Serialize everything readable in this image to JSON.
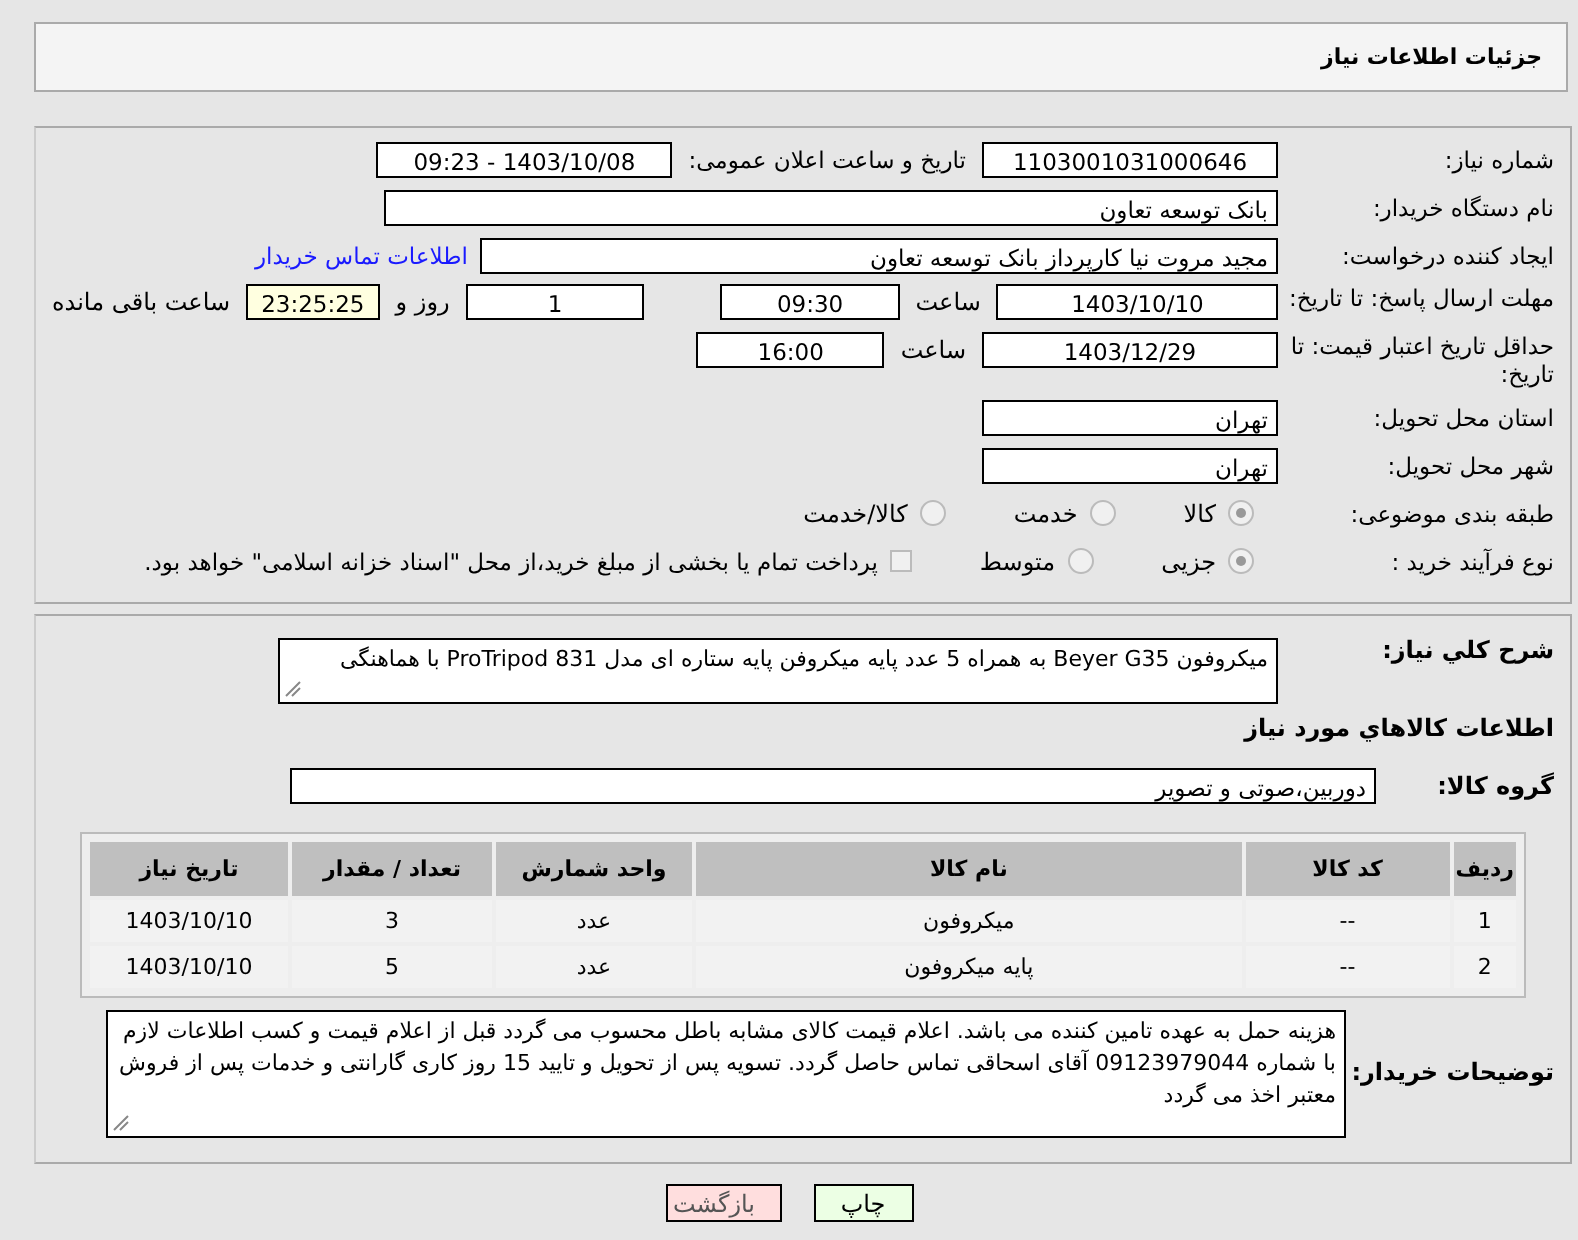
{
  "header": {
    "title": "جزئیات اطلاعات نیاز"
  },
  "need_number": {
    "label": "شماره نیاز:",
    "value": "1103001031000646"
  },
  "announce": {
    "label": "تاریخ و ساعت اعلان عمومی:",
    "value": "1403/10/08 - 09:23"
  },
  "buyer": {
    "label": "نام دستگاه خریدار:",
    "value": "بانک توسعه تعاون"
  },
  "creator": {
    "label": "ایجاد کننده درخواست:",
    "value": "مجید مروت نیا کارپرداز بانک توسعه تعاون",
    "link": "اطلاعات تماس خریدار"
  },
  "deadline": {
    "label": "مهلت ارسال پاسخ: تا تاریخ:",
    "date": "1403/10/10",
    "time_label": "ساعت",
    "time": "09:30",
    "days": "1",
    "days_label": "روز و",
    "remaining": "23:25:25",
    "remaining_label": "ساعت باقی مانده"
  },
  "validity": {
    "label": "حداقل تاریخ اعتبار قیمت: تا تاریخ:",
    "date": "1403/12/29",
    "time_label": "ساعت",
    "time": "16:00"
  },
  "province": {
    "label": "استان محل تحویل:",
    "value": "تهران"
  },
  "city": {
    "label": "شهر محل تحویل:",
    "value": "تهران"
  },
  "category": {
    "label": "طبقه بندی موضوعی:",
    "options": [
      {
        "label": "کالا",
        "selected": true
      },
      {
        "label": "خدمت",
        "selected": false
      },
      {
        "label": "کالا/خدمت",
        "selected": false
      }
    ]
  },
  "purchase_type": {
    "label": "نوع فرآیند خرید :",
    "options": [
      {
        "label": "جزیی",
        "selected": true
      },
      {
        "label": "متوسط",
        "selected": false
      }
    ],
    "payment": {
      "label": "پرداخت تمام یا بخشی از مبلغ خرید،از محل \"اسناد خزانه اسلامی\" خواهد بود.",
      "checked": false
    }
  },
  "summary": {
    "label": "شرح کلي نياز:",
    "value": "میکروفون  Beyer G35 به همراه 5 عدد پایه میکروفن پایه ستاره ای مدل ProTripod 831 با هماهنگی"
  },
  "goods_heading": "اطلاعات کالاهاي مورد نياز",
  "goods_group": {
    "label": "گروه کالا:",
    "value": "دوربین،صوتی و تصویر"
  },
  "table": {
    "columns": [
      "ردیف",
      "کد کالا",
      "نام کالا",
      "واحد شمارش",
      "تعداد / مقدار",
      "تاریخ نیاز"
    ],
    "rows": [
      [
        "1",
        "--",
        "میکروفون",
        "عدد",
        "3",
        "1403/10/10"
      ],
      [
        "2",
        "--",
        "پایه میکروفون",
        "عدد",
        "5",
        "1403/10/10"
      ]
    ]
  },
  "notes": {
    "label": "توضیحات خریدار:",
    "value": "هزینه حمل به عهده تامین کننده می باشد. اعلام قیمت کالای مشابه باطل محسوب می گردد قبل از اعلام قیمت و کسب اطلاعات لازم با شماره 09123979044 آقای اسحاقی تماس حاصل گردد. تسویه پس از تحویل و تایید 15 روز کاری گارانتی و خدمات پس از فروش معتبر اخذ می گردد"
  },
  "buttons": [
    {
      "label": "چاپ",
      "kind": "print"
    },
    {
      "label": "بازگشت",
      "kind": "back"
    }
  ]
}
